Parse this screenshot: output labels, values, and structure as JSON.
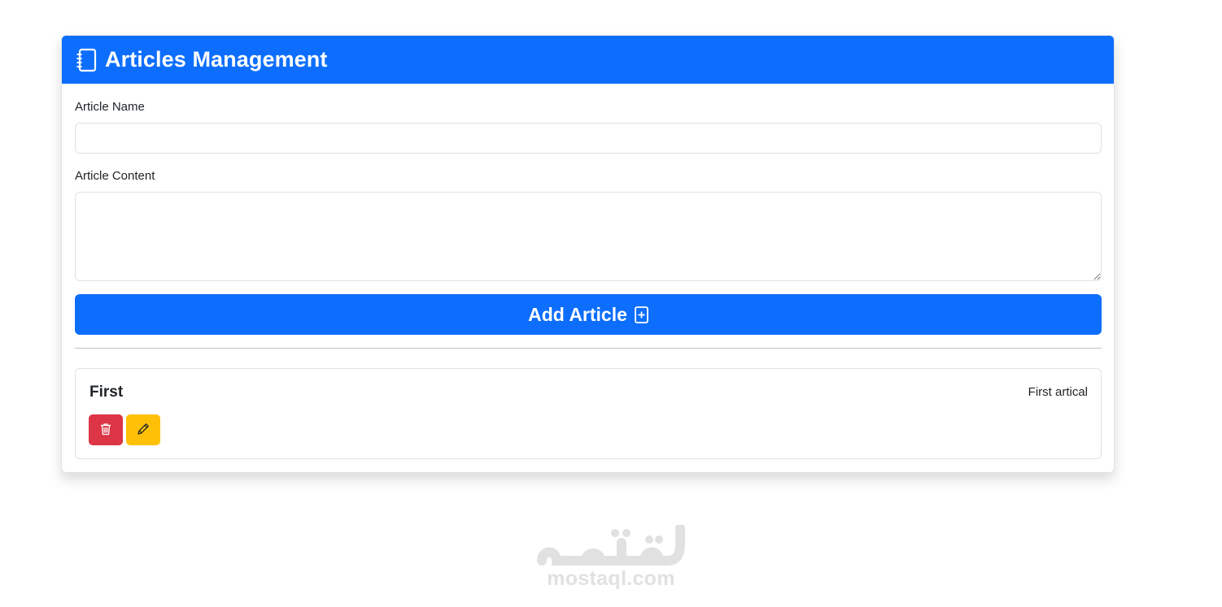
{
  "header": {
    "title": "Articles Management",
    "icon": "notebook-icon"
  },
  "form": {
    "name_label": "Article Name",
    "name_value": "",
    "content_label": "Article Content",
    "content_value": "",
    "add_button_label": "Add Article",
    "add_button_icon": "plus-square-icon"
  },
  "articles": [
    {
      "title": "First",
      "content": "First artical",
      "delete_icon": "trash-icon",
      "edit_icon": "pencil-icon"
    }
  ],
  "colors": {
    "primary": "#0d6efd",
    "danger": "#dc3545",
    "warning": "#ffc107"
  },
  "watermark": {
    "logo_text": "مستقل",
    "domain": "mostaql.com"
  }
}
